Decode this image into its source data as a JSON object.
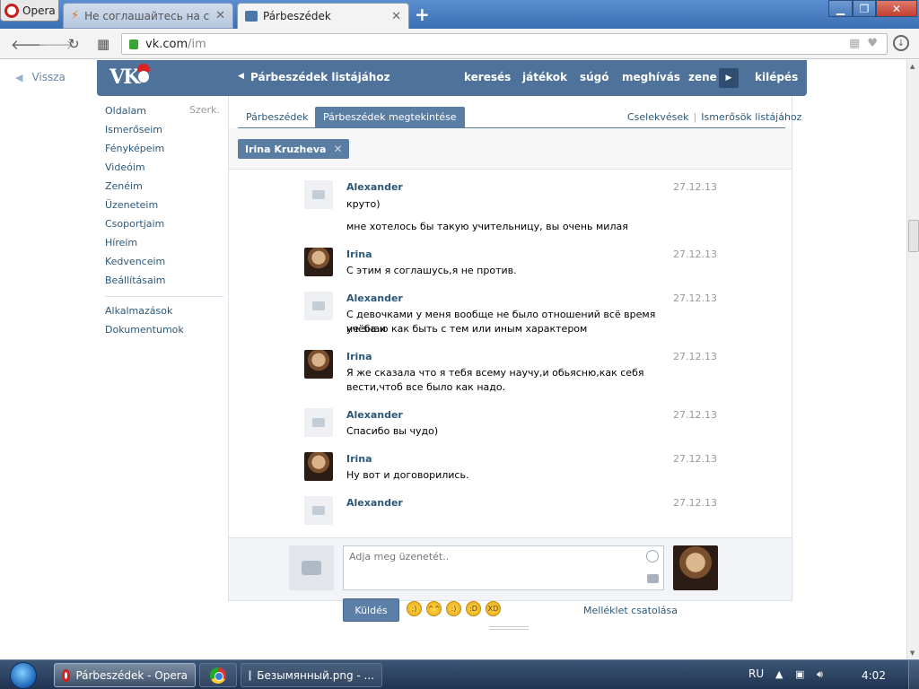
{
  "browser": {
    "app_button": "Opera",
    "tabs": [
      {
        "title": "Не соглашайтесь на секс"
      },
      {
        "title": "Párbeszédek"
      }
    ],
    "url_domain": "vk.com",
    "url_path": "/im",
    "icons": {
      "back": "back-arrow-icon",
      "forward": "forward-arrow-icon",
      "reload": "reload-icon",
      "speed_dial": "grid-icon",
      "lock": "lock-icon",
      "bookmark": "heart-icon",
      "download": "download-icon"
    }
  },
  "page": {
    "back_link": "Vissza",
    "header": {
      "dialogs_list": "Párbeszédek listájához",
      "links": [
        "keresés",
        "játékok",
        "súgó",
        "meghívás",
        "zene",
        "kilépés"
      ]
    },
    "sidebar": {
      "items": [
        "Oldalam",
        "Ismerőseim",
        "Fényképeim",
        "Videóim",
        "Zenéim",
        "Üzeneteim",
        "Csoportjaim",
        "Híreim",
        "Kedvenceim",
        "Beállításaim"
      ],
      "edit": "Szerk.",
      "extra": [
        "Alkalmazások",
        "Dokumentumok"
      ]
    },
    "tabs": [
      "Párbeszédek",
      "Párbeszédek megtekintése"
    ],
    "top_links": [
      "Cselekvések",
      "Ismerősök listájához"
    ],
    "peer": "Irina Kruzheva",
    "messages": [
      {
        "author": "Alexander",
        "date": "27.12.13",
        "avatar": "camera-placeholder",
        "lines": [
          "круто)"
        ]
      },
      {
        "author": "",
        "date": "",
        "avatar": "",
        "lines": [
          "мне хотелось бы такую учительницу, вы очень милая"
        ]
      },
      {
        "author": "Irina",
        "date": "27.12.13",
        "avatar": "photo",
        "lines": [
          "С этим я соглашусь,я не против."
        ]
      },
      {
        "author": "Alexander",
        "date": "27.12.13",
        "avatar": "camera-placeholder",
        "lines": [
          "С девочками у меня вообще не было отношений всё время учёба и",
          "не знаю как быть с тем или иным характером"
        ]
      },
      {
        "author": "Irina",
        "date": "27.12.13",
        "avatar": "photo",
        "lines": [
          "Я же сказала что я тебя всему научу,и обьясню,как себя",
          "вести,чтоб все было как надо."
        ]
      },
      {
        "author": "Alexander",
        "date": "27.12.13",
        "avatar": "camera-placeholder",
        "lines": [
          "Спасибо вы чудо)"
        ]
      },
      {
        "author": "Irina",
        "date": "27.12.13",
        "avatar": "photo",
        "lines": [
          "Ну вот и договорились."
        ]
      },
      {
        "author": "Alexander",
        "date": "27.12.13",
        "avatar": "camera-placeholder",
        "lines": []
      }
    ],
    "composer": {
      "placeholder": "Adja meg üzenetét..",
      "send": "Küldés",
      "attach": "Melléklet csatolása",
      "emojis": [
        "wink",
        "blush",
        "smile",
        "grin",
        "laugh"
      ]
    }
  },
  "taskbar": {
    "items": [
      "Párbeszédek - Opera",
      "",
      "Безымянный.png - ..."
    ],
    "lang": "RU",
    "clock": "4:02"
  }
}
